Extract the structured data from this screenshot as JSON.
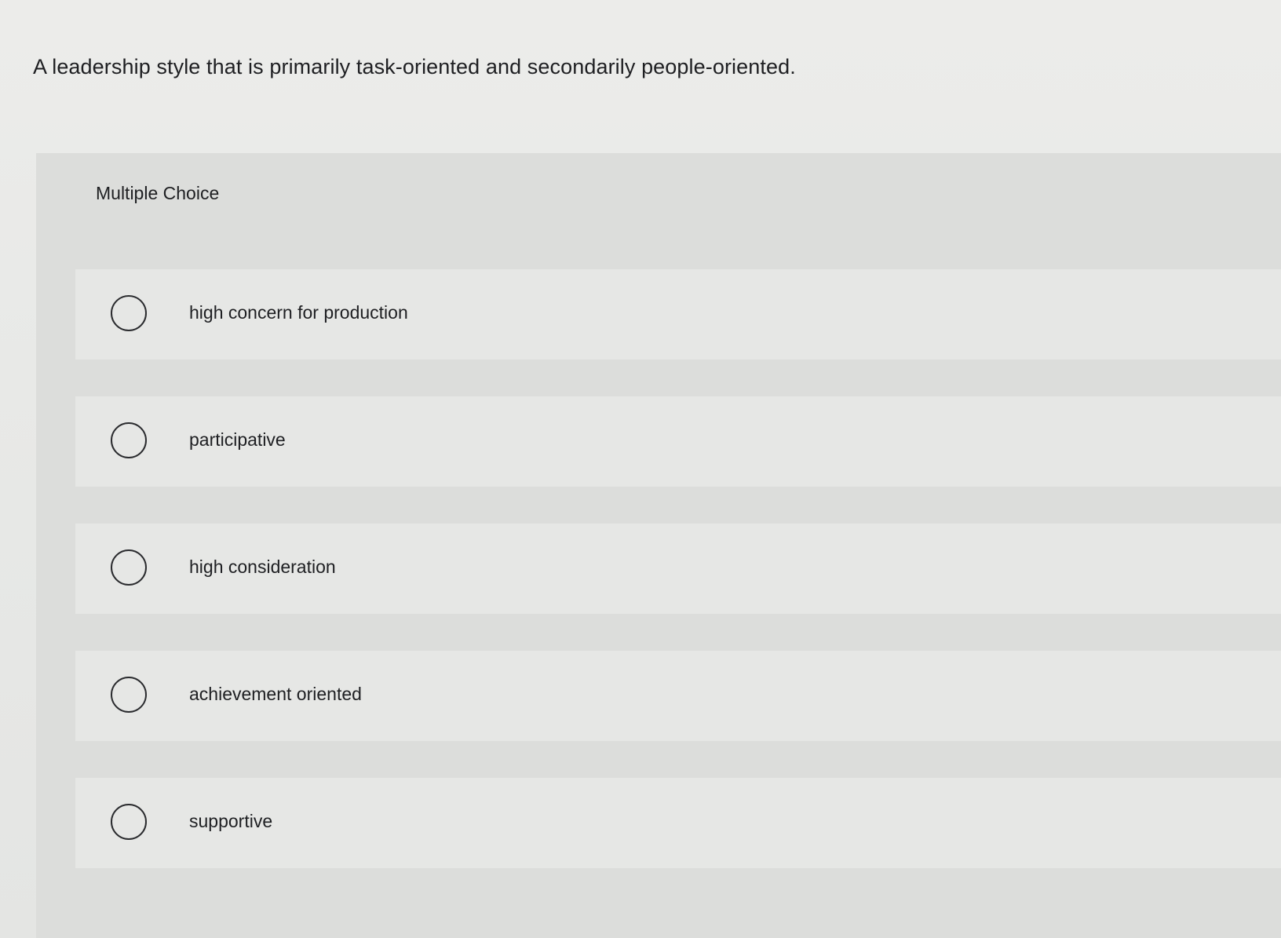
{
  "question": {
    "text": "A leadership style that is primarily task-oriented and secondarily people-oriented."
  },
  "panel": {
    "header": "Multiple Choice"
  },
  "choices": [
    {
      "label": "high concern for production"
    },
    {
      "label": "participative"
    },
    {
      "label": "high consideration"
    },
    {
      "label": "achievement oriented"
    },
    {
      "label": "supportive"
    }
  ],
  "colors": {
    "background": "#e9eae8",
    "panel": "#dcdddb",
    "choice_background": "#e6e7e5",
    "text": "#1e1f22",
    "radio_border": "#2a2b2e"
  }
}
